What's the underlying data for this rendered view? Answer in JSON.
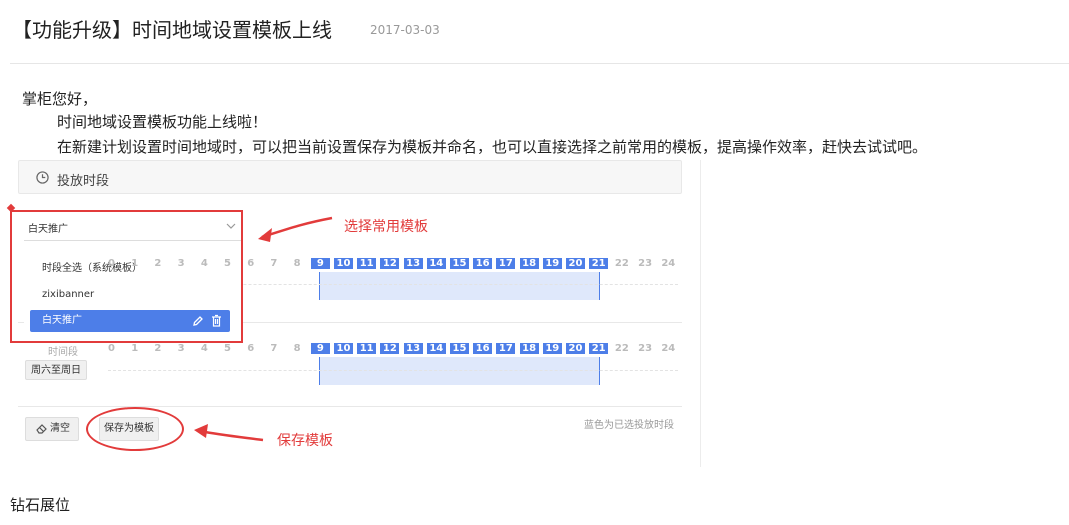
{
  "article": {
    "title": "【功能升级】时间地域设置模板上线",
    "date": "2017-03-03",
    "greeting": "掌柜您好，",
    "line1": "时间地域设置模板功能上线啦！",
    "line2": "在新建计划设置时间地域时，可以把当前设置保存为模板并命名，也可以直接选择之前常用的模板，提高操作效率，赶快去试试吧。"
  },
  "panel": {
    "title": "投放时段",
    "select_value": "白天推广",
    "options": [
      "时段全选（系统模板）",
      "zixibanner",
      "白天推广"
    ],
    "selected_option": "白天推广",
    "hours": [
      "0",
      "1",
      "2",
      "3",
      "4",
      "5",
      "6",
      "7",
      "8",
      "9",
      "10",
      "11",
      "12",
      "13",
      "14",
      "15",
      "16",
      "17",
      "18",
      "19",
      "20",
      "21",
      "22",
      "23",
      "24"
    ],
    "selected_range": [
      9,
      21
    ],
    "time_label": "时间段",
    "weekend_button": "周六至周日",
    "clear_button": "清空",
    "save_template_button": "保存为模板",
    "legend": "蓝色为已选投放时段"
  },
  "annotations": {
    "select_template": "选择常用模板",
    "save_template": "保存模板",
    "color": "#e23b3b"
  },
  "accent_color": "#4d7ee8",
  "section_heading": "钻石展位"
}
